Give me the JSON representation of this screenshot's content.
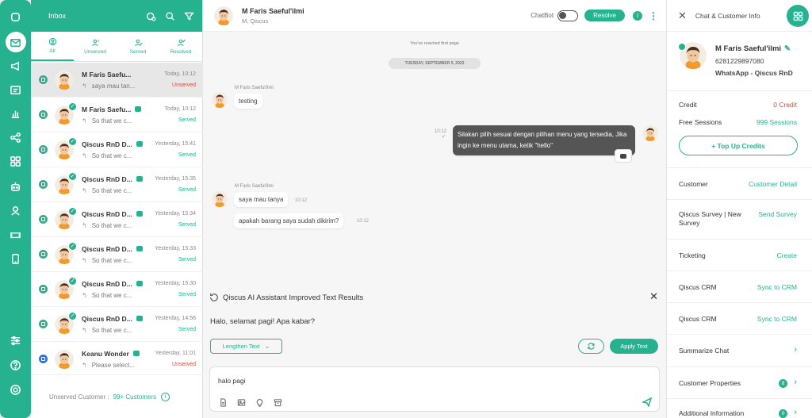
{
  "rail": {
    "items": [
      "app-icon",
      "inbox-icon",
      "broadcast-icon",
      "contacts-icon",
      "analytics-icon",
      "integration-icon",
      "apps-icon",
      "bot-icon",
      "agents-icon",
      "ticket-icon",
      "mobile-icon",
      "settings-icon",
      "help-icon",
      "profile-icon"
    ]
  },
  "inbox": {
    "title": "Inbox",
    "tabs": [
      {
        "label": "All"
      },
      {
        "label": "Unserved"
      },
      {
        "label": "Served"
      },
      {
        "label": "Resolved"
      }
    ],
    "conversations": [
      {
        "name": "M Faris Saefu...",
        "preview": "saya mau tan...",
        "time": "Today, 10:12",
        "status": "Unserved",
        "channel": "whatsapp",
        "bot": false,
        "reply": false,
        "verified": false
      },
      {
        "name": "M Faris Saefu...",
        "preview": "So that we c...",
        "time": "Today, 10:12",
        "status": "Served",
        "channel": "whatsapp",
        "bot": true,
        "reply": true,
        "verified": true
      },
      {
        "name": "Qiscus RnD D...",
        "preview": "So that we c...",
        "time": "Yesterday, 15:41",
        "status": "Served",
        "channel": "widget",
        "bot": true,
        "reply": true,
        "verified": true
      },
      {
        "name": "Qiscus RnD D...",
        "preview": "So that we c...",
        "time": "Yesterday, 15:35",
        "status": "Served",
        "channel": "widget",
        "bot": true,
        "reply": true,
        "verified": true
      },
      {
        "name": "Qiscus RnD D...",
        "preview": "So that we c...",
        "time": "Yesterday, 15:34",
        "status": "Served",
        "channel": "widget",
        "bot": true,
        "reply": true,
        "verified": true
      },
      {
        "name": "Qiscus RnD D...",
        "preview": "So that we c...",
        "time": "Yesterday, 15:33",
        "status": "Served",
        "channel": "widget",
        "bot": true,
        "reply": true,
        "verified": true
      },
      {
        "name": "Qiscus RnD D...",
        "preview": "So that we c...",
        "time": "Yesterday, 15:30",
        "status": "Served",
        "channel": "widget",
        "bot": true,
        "reply": true,
        "verified": true
      },
      {
        "name": "Qiscus RnD D...",
        "preview": "So that we c...",
        "time": "Yesterday, 14:56",
        "status": "Served",
        "channel": "widget",
        "bot": true,
        "reply": true,
        "verified": true
      },
      {
        "name": "Keanu Wonder",
        "preview": "Please select...",
        "time": "Yesterday, 11:01",
        "status": "Unserved",
        "channel": "messenger",
        "bot": true,
        "reply": true,
        "verified": false
      }
    ],
    "footer_label": "Unserved Customer :",
    "footer_value": "99+ Customers"
  },
  "chat": {
    "name": "M Faris Saeful'ilmi",
    "sub": "M, Qiscus",
    "chatbot_label": "ChatBot",
    "resolve_label": "Resolve",
    "first_page": "You've reached first page",
    "date": "TUESDAY, SEPTEMBER 5, 2023",
    "msg1_sender": "M Faris Saeful'ilmi",
    "msg1": "testing",
    "out_time": "10:12",
    "out_msg": "Silakan pilih sesuai dengan pilihan menu yang tersedia, Jika ingin ke menu utama, ketik \"hello\"",
    "msg2_sender": "M Faris Saeful'ilmi",
    "msg2": "saya mau tanya",
    "msg2_time": "10:12",
    "msg3": "apakah barang saya sudah dikirim?",
    "msg3_time": "10:12"
  },
  "ai": {
    "title": "Qiscus AI Assistant Improved Text Results",
    "result": "Halo, selamat pagi! Apa kabar?",
    "mode": "Lengthen Text",
    "apply": "Apply Text"
  },
  "composer": {
    "value": "halo pagi"
  },
  "info": {
    "title": "Chat & Customer Info",
    "name": "M Faris Saeful'ilmi",
    "phone": "6281229897080",
    "channel": "WhatsApp - Qiscus RnD",
    "credit_label": "Credit",
    "credit_value": "0 Credit",
    "sessions_label": "Free Sessions",
    "sessions_value": "999 Sessions",
    "topup": "+ Top Up Credits",
    "rows": [
      {
        "label": "Customer",
        "action": "Customer Detail"
      },
      {
        "label": "Qiscus Survey | New Survey",
        "action": "Send Survey"
      },
      {
        "label": "Ticketing",
        "action": "Create"
      },
      {
        "label": "Qiscus CRM",
        "action": "Sync to CRM"
      },
      {
        "label": "Qiscus CRM",
        "action": "Sync to CRM"
      },
      {
        "label": "Summarize Chat",
        "action": ""
      },
      {
        "label": "Customer Properties",
        "action": "",
        "badge": "8"
      },
      {
        "label": "Additional Information",
        "action": "",
        "badge": "0"
      }
    ]
  },
  "colors": {
    "accent": "#27b28f",
    "unserved": "#e04a3c"
  }
}
